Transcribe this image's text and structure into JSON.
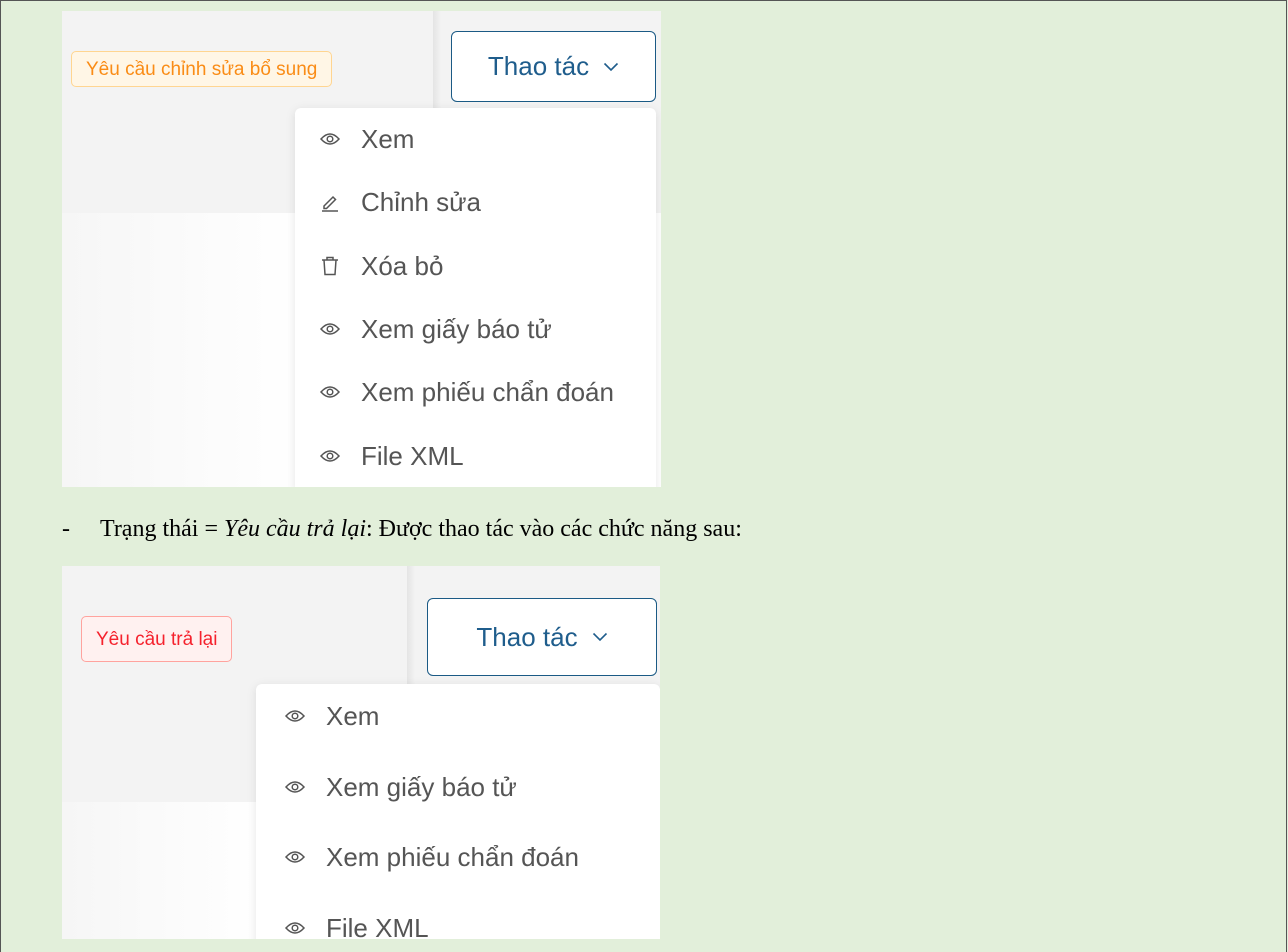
{
  "section1": {
    "status_badge": "Yêu cầu chỉnh sửa bổ sung",
    "action_button": "Thao tác",
    "menu_items": [
      "Xem",
      "Chỉnh sửa",
      "Xóa bỏ",
      "Xem giấy báo tử",
      "Xem phiếu chẩn đoán",
      "File XML"
    ],
    "menu_icons": [
      "eye-icon",
      "pencil-icon",
      "trash-icon",
      "eye-icon",
      "eye-icon",
      "eye-icon"
    ]
  },
  "caption": {
    "bullet": "-",
    "prefix": "Trạng thái = ",
    "status": "Yêu cầu trả lại",
    "suffix": ": Được thao tác vào các chức năng sau:"
  },
  "section2": {
    "status_badge": "Yêu cầu trả lại",
    "action_button": "Thao tác",
    "menu_items": [
      "Xem",
      "Xem giấy báo tử",
      "Xem phiếu chẩn đoán",
      "File XML"
    ],
    "menu_icons": [
      "eye-icon",
      "eye-icon",
      "eye-icon",
      "eye-icon"
    ]
  },
  "colors": {
    "page_background": "#e2efda",
    "badge_orange_text": "#fa8c16",
    "badge_red_text": "#f5222d",
    "button_border": "#1b5a85",
    "menu_text": "#555555"
  }
}
